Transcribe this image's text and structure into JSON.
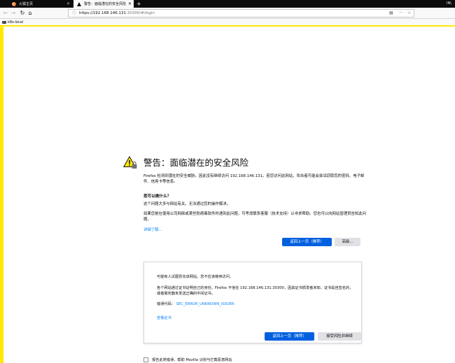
{
  "browser": {
    "tabs": [
      {
        "label": "火狐主页",
        "active": false
      },
      {
        "label": "警告：面临潜在的安全风险",
        "active": true
      }
    ],
    "new_tab": "+",
    "library_icon": "IN\\",
    "url": {
      "prefix": "https://",
      "host": "192.168.146.131",
      "rest": ":30300/#/login"
    },
    "bookmarks": [
      {
        "label": "k8s-local"
      }
    ]
  },
  "page": {
    "accent_color": "#ffe900",
    "title": "警告：面临潜在的安全风险",
    "intro": "Firefox 检测到潜在的安全威胁，因此没有继续访问 192.168.146.131。若您访问此网站，攻击者可能会尝试窃取您的密码、电子邮件、信用卡等信息。",
    "what_heading": "您可以做什么？",
    "what_text1": "这个问题大多与网站有关，无法通过您的操作解决。",
    "what_text2": "如果您是在使用公司网络或某些防病毒软件时遇到此问题，可考虑联系客服（技术支持）以寻求帮助。您也可以向网站管理员告知此问题。",
    "learn_more": "详细了解...",
    "back_button": "返回上一页（推荐）",
    "advanced_button": "高级...",
    "advanced_panel": {
      "text1": "可能有人试图冒充该网站。您不应该继续访问。",
      "text2": "各个网站通过证书证明自己的身份。Firefox 不信任 192.168.146.131:30300，因其证书颁发者未知、证书是自签名的，或者服务器未发送正确的中间证书。",
      "error_label": "错误代码：",
      "error_code": "SEC_ERROR_UNKNOWN_ISSUER",
      "view_cert": "查看证书",
      "back_button": "返回上一页（推荐）",
      "accept_button": "接受风险并继续"
    },
    "report_checkbox_label": "报告此类错误，帮助 Mozilla 识别与拦截恶意网站"
  }
}
